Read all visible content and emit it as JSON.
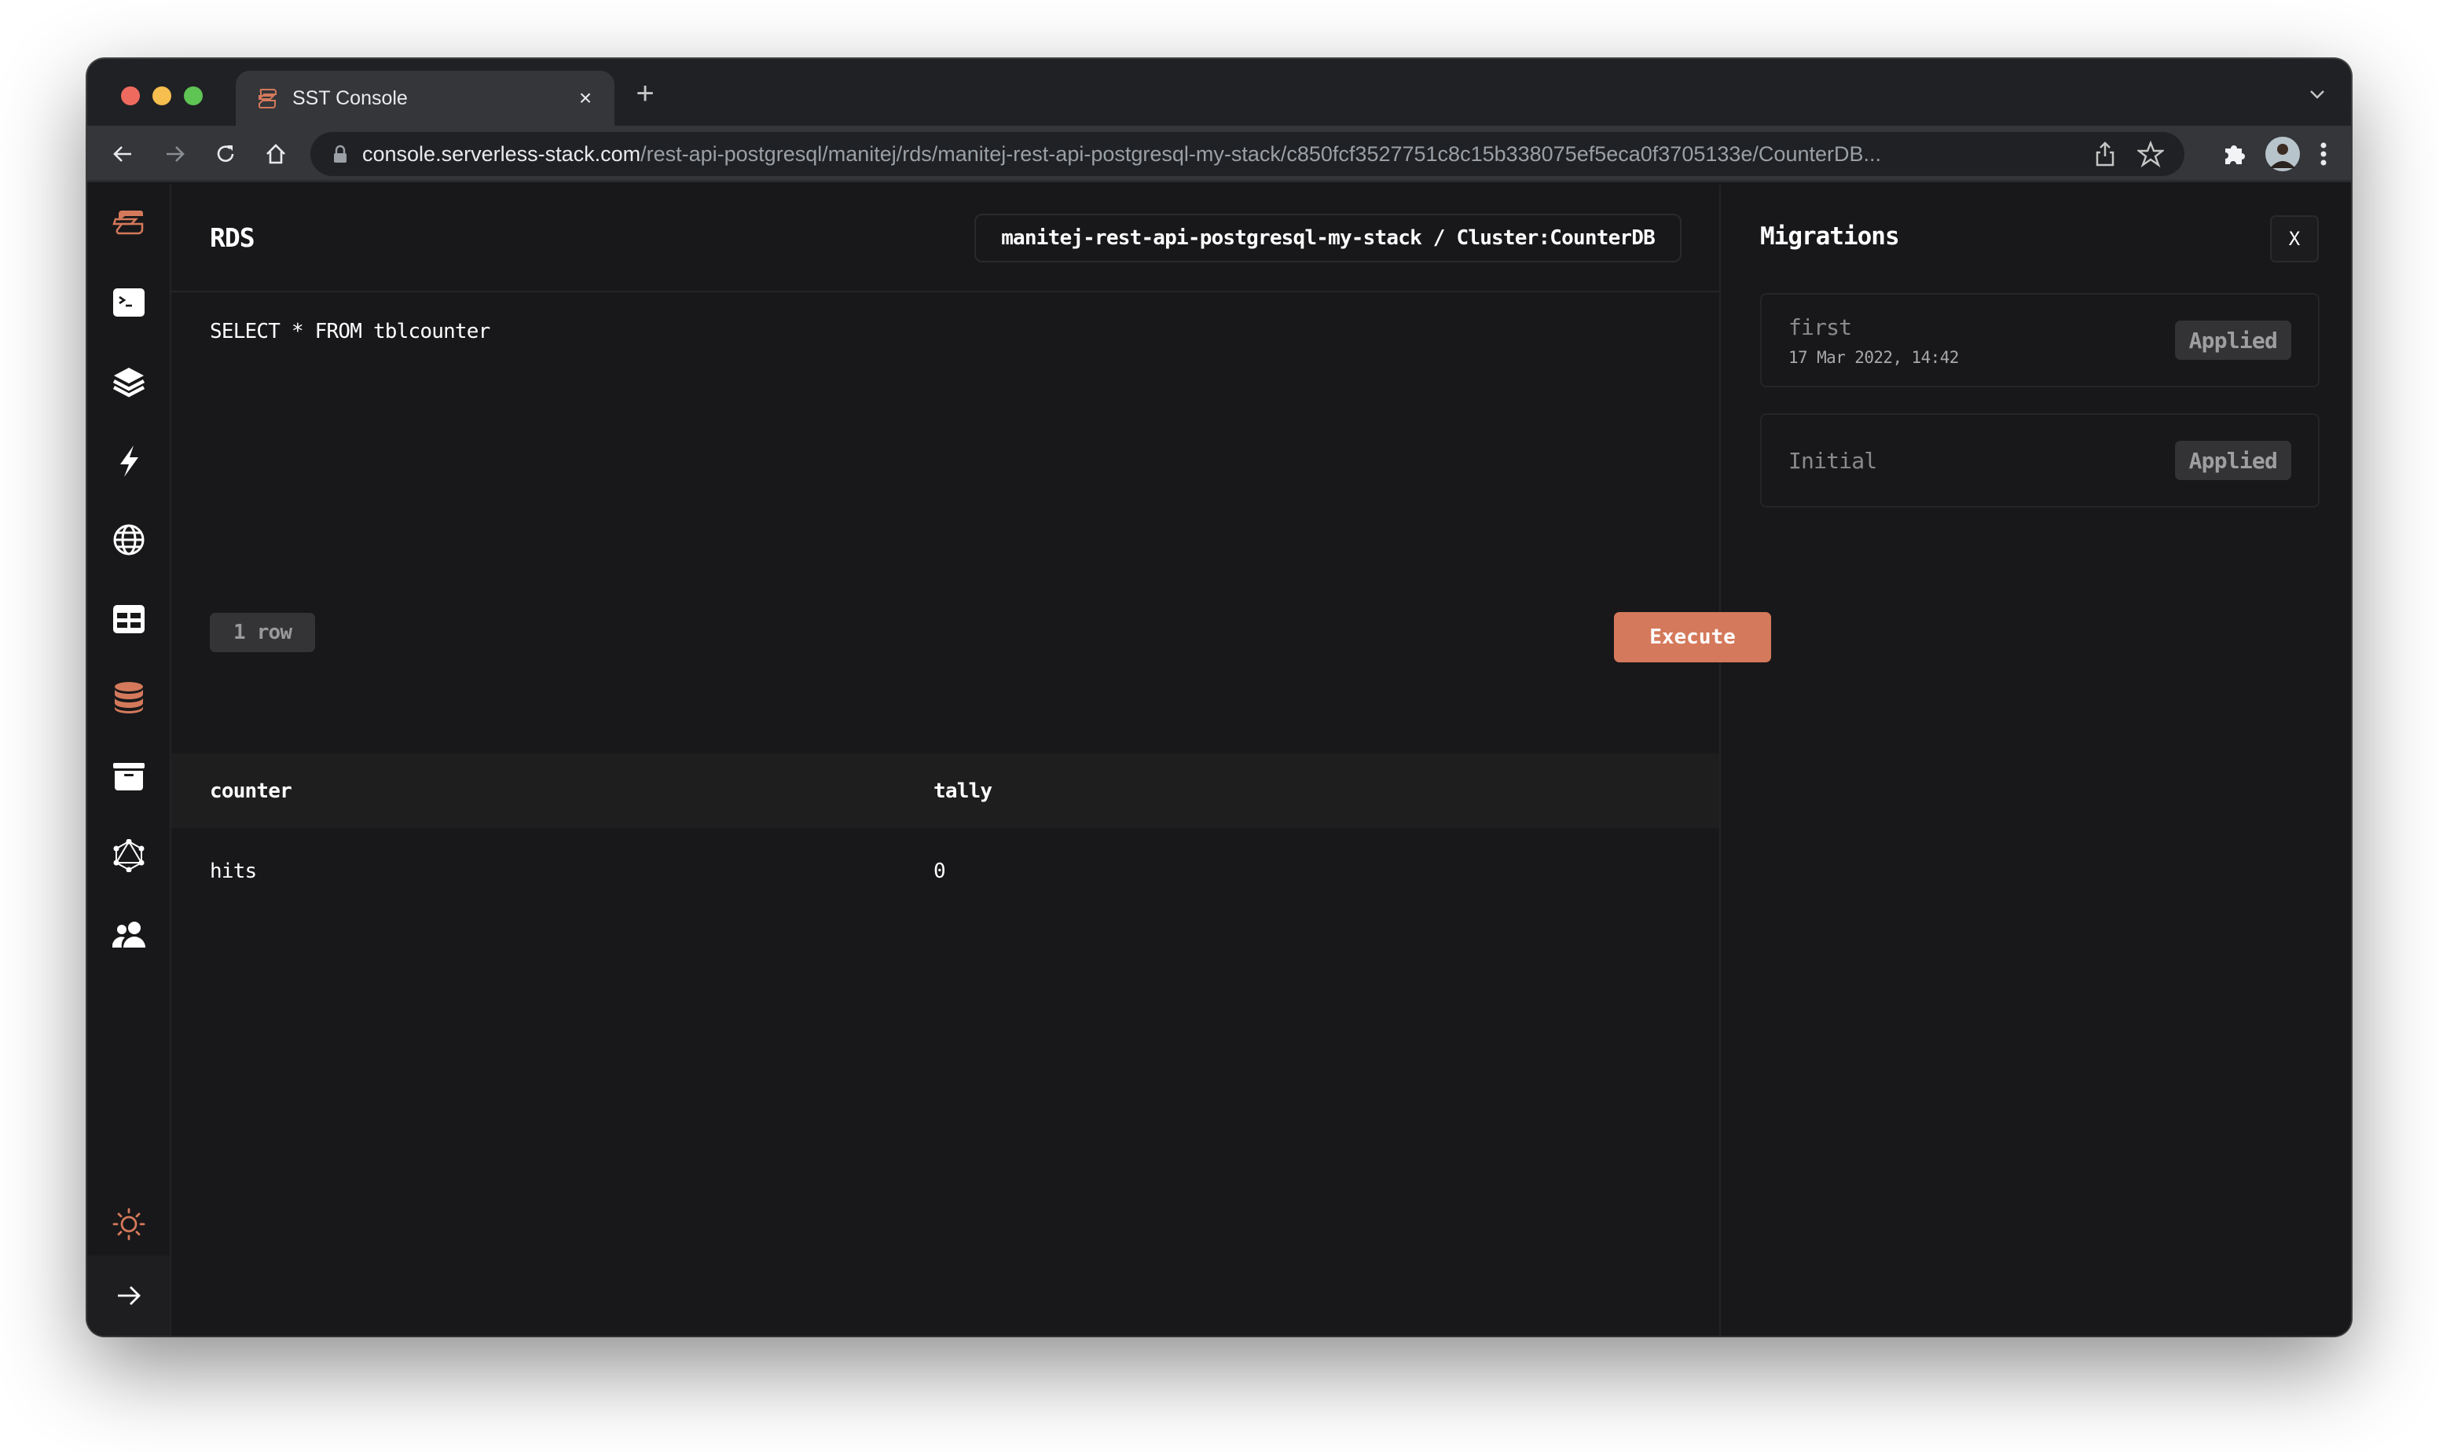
{
  "browser": {
    "tab": {
      "title": "SST Console",
      "favicon": "sst-logo-icon",
      "close_label": "×"
    },
    "new_tab_label": "+",
    "url": {
      "host": "console.serverless-stack.com",
      "path": "/rest-api-postgresql/manitej/rds/manitej-rest-api-postgresql-my-stack/c850fcf3527751c8c15b338075ef5eca0f3705133e/CounterDB..."
    },
    "toolbar_icons": [
      "back-icon",
      "forward-icon",
      "reload-icon",
      "home-icon",
      "lock-icon",
      "share-icon",
      "star-icon",
      "extensions-icon",
      "profile-avatar",
      "menu-icon"
    ]
  },
  "sidebar": {
    "items": [
      {
        "name": "sst-logo",
        "icon": "sst-logo-icon",
        "active": false
      },
      {
        "name": "local",
        "icon": "terminal-icon",
        "active": false
      },
      {
        "name": "stacks",
        "icon": "layers-icon",
        "active": false
      },
      {
        "name": "functions",
        "icon": "bolt-icon",
        "active": false
      },
      {
        "name": "api",
        "icon": "globe-icon",
        "active": false
      },
      {
        "name": "dynamodb",
        "icon": "table-icon",
        "active": false
      },
      {
        "name": "rds",
        "icon": "database-icon",
        "active": true
      },
      {
        "name": "buckets",
        "icon": "archive-icon",
        "active": false
      },
      {
        "name": "graphql",
        "icon": "graphql-icon",
        "active": false
      },
      {
        "name": "cognito",
        "icon": "users-icon",
        "active": false
      }
    ],
    "theme_toggle": "sun-icon",
    "expand": "arrow-right-icon"
  },
  "main": {
    "title": "RDS",
    "breadcrumb": "manitej-rest-api-postgresql-my-stack / Cluster:CounterDB",
    "query": "SELECT * FROM tblcounter",
    "row_count": "1 row",
    "execute_label": "Execute",
    "results": {
      "columns": [
        "counter",
        "tally"
      ],
      "rows": [
        [
          "hits",
          "0"
        ]
      ]
    }
  },
  "migrations": {
    "title": "Migrations",
    "close_label": "X",
    "items": [
      {
        "name": "first",
        "date": "17 Mar 2022, 14:42",
        "status": "Applied"
      },
      {
        "name": "Initial",
        "date": "",
        "status": "Applied"
      }
    ]
  },
  "colors": {
    "accent": "#d4795b",
    "background": "#18181a",
    "badge_bg": "#333335"
  }
}
